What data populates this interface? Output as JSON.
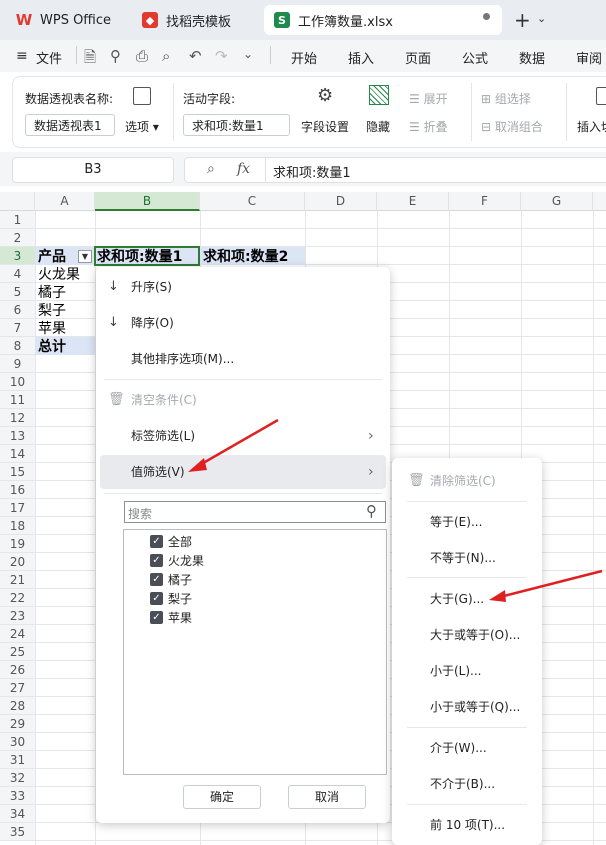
{
  "tabs": [
    {
      "label": "WPS Office",
      "icon": "wps-logo-icon"
    },
    {
      "label": "找稻壳模板",
      "icon": "docer-icon"
    },
    {
      "label": "工作簿数量.xlsx",
      "icon": "spreadsheet-icon"
    }
  ],
  "menu": {
    "file": "文件",
    "items": [
      "开始",
      "插入",
      "页面",
      "公式",
      "数据",
      "审阅"
    ]
  },
  "ribbon": {
    "pivot_name_label": "数据透视表名称:",
    "pivot_name_value": "数据透视表1",
    "options": "选项",
    "active_field_label": "活动字段:",
    "active_field_value": "求和项:数量1",
    "field_settings": "字段设置",
    "hide": "隐藏",
    "expand": "展开",
    "collapse": "折叠",
    "group_select": "组选择",
    "ungroup": "取消组合",
    "insert": "插入切"
  },
  "formula_bar": {
    "cell_ref": "B3",
    "fx": "fx",
    "value": "求和项:数量1"
  },
  "columns": [
    "A",
    "B",
    "C",
    "D",
    "E",
    "F",
    "G"
  ],
  "rows": [
    "1",
    "2",
    "3",
    "4",
    "5",
    "6",
    "7",
    "8",
    "9",
    "10",
    "11",
    "12",
    "13",
    "14",
    "15",
    "16",
    "17",
    "18",
    "19",
    "20",
    "21",
    "22",
    "23",
    "24",
    "25",
    "26",
    "27",
    "28",
    "29",
    "30",
    "31",
    "32",
    "33",
    "34",
    "35"
  ],
  "cells": {
    "a3": "产品",
    "b3": "求和项:数量1",
    "c3": "求和项:数量2",
    "a4": "火龙果",
    "a5": "橘子",
    "a6": "梨子",
    "a7": "苹果",
    "a8": "总计"
  },
  "dropdown": {
    "sort_asc": "升序(S)",
    "sort_desc": "降序(O)",
    "more_sort": "其他排序选项(M)...",
    "clear": "清空条件(C)",
    "label_filter": "标签筛选(L)",
    "value_filter": "值筛选(V)",
    "search_placeholder": "搜索",
    "checklist": [
      "全部",
      "火龙果",
      "橘子",
      "梨子",
      "苹果"
    ],
    "ok": "确定",
    "cancel": "取消"
  },
  "submenu": {
    "clear": "清除筛选(C)",
    "items": [
      "等于(E)...",
      "不等于(N)...",
      "大于(G)...",
      "大于或等于(O)...",
      "小于(L)...",
      "小于或等于(Q)...",
      "介于(W)...",
      "不介于(B)...",
      "前 10 项(T)..."
    ]
  },
  "colors": {
    "accent": "#2e7d32",
    "arrow": "#e02020",
    "highlight": "#dbe5f5"
  }
}
